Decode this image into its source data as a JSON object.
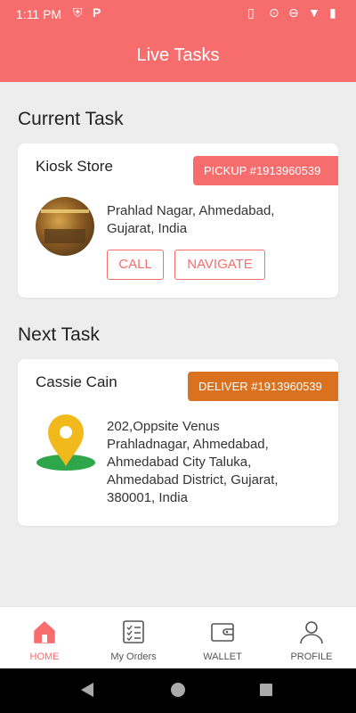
{
  "status_bar": {
    "time": "1:11 PM",
    "left_icons": [
      "shield-icon",
      "parking-app-icon"
    ],
    "right_icons": [
      "vibrate-icon",
      "location-icon",
      "dnd-icon",
      "wifi-icon",
      "battery-icon"
    ],
    "app_letter": "P"
  },
  "header": {
    "title": "Live Tasks"
  },
  "current": {
    "section_title": "Current Task",
    "name": "Kiosk Store",
    "badge": "PICKUP #1913960539",
    "address": "Prahlad Nagar, Ahmedabad,\nGujarat, India",
    "call_label": "CALL",
    "navigate_label": "NAVIGATE"
  },
  "next": {
    "section_title": "Next Task",
    "name": "Cassie Cain",
    "badge": "DELIVER #1913960539",
    "address": "202,Oppsite Venus\nPrahladnagar, Ahmedabad,\nAhmedabad City Taluka,\nAhmedabad District, Gujarat,\n380001, India"
  },
  "nav": {
    "items": [
      {
        "label": "HOME",
        "icon": "home-icon",
        "active": true
      },
      {
        "label": "My Orders",
        "icon": "orders-icon",
        "active": false
      },
      {
        "label": "WALLET",
        "icon": "wallet-icon",
        "active": false
      },
      {
        "label": "PROFILE",
        "icon": "profile-icon",
        "active": false
      }
    ]
  },
  "colors": {
    "accent": "#f76d6d",
    "deliver": "#d9711f",
    "pin_yellow": "#f2b91c",
    "pin_green": "#2ea64a"
  }
}
